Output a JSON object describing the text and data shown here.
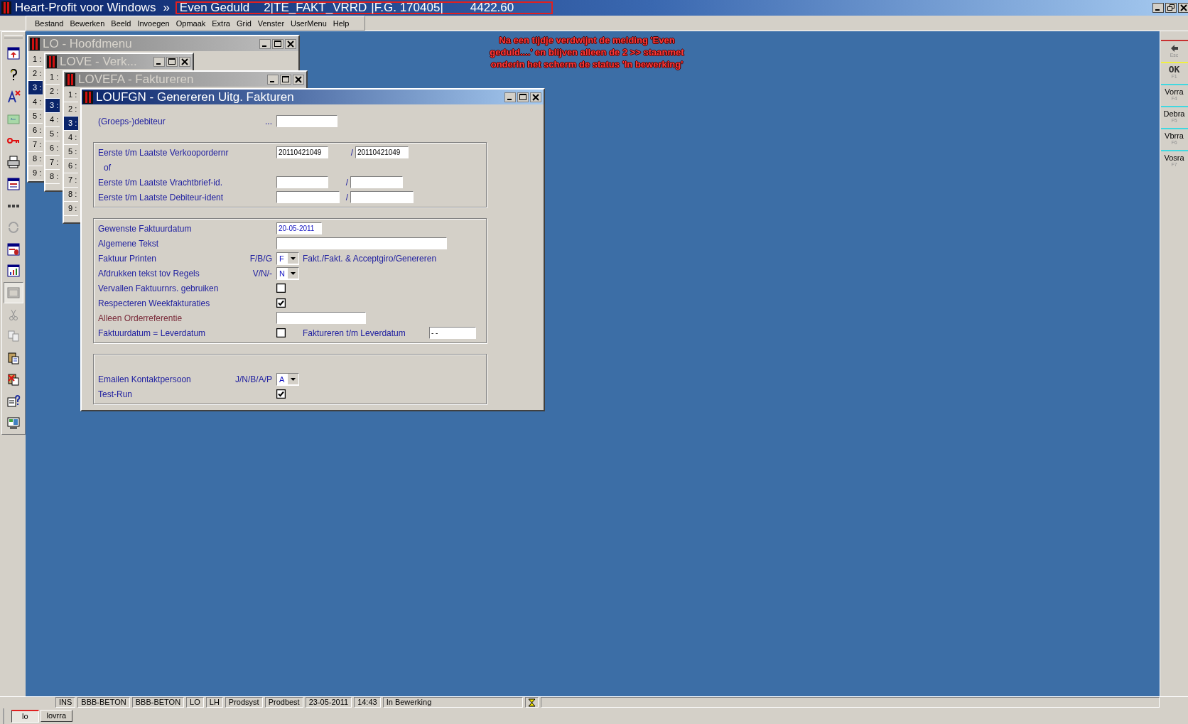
{
  "app_title": {
    "name": "Heart-Profit voor Windows",
    "separator": "»",
    "status": [
      "Even Geduld",
      "2|TE_FAKT_VRRD",
      "|F.G. 170405|",
      "4422.60"
    ]
  },
  "menu": [
    "Bestand",
    "Bewerken",
    "Beeld",
    "Invoegen",
    "Opmaak",
    "Extra",
    "Grid",
    "Venster",
    "UserMenu",
    "Help"
  ],
  "annotation": [
    "Na een tijdje verdwijnt de melding 'Even",
    "geduld....' en blijven alleen de 2 >> staanmet",
    "onderin het scherm de status 'In bewerking'"
  ],
  "windows": [
    {
      "title": "LO - Hoofdmenu",
      "active": false,
      "items": [
        {
          "label": "1 :",
          "selected": false
        },
        {
          "label": "2 :",
          "selected": false
        },
        {
          "label": "3 :",
          "selected": true
        },
        {
          "label": "4 :",
          "selected": false
        },
        {
          "label": "5 :",
          "selected": false
        },
        {
          "label": "6 :",
          "selected": false
        },
        {
          "label": "7 :",
          "selected": false
        },
        {
          "label": "8 :",
          "selected": false
        },
        {
          "label": "9 :",
          "selected": false
        }
      ]
    },
    {
      "title": "LOVE - Verk...",
      "active": false,
      "items": [
        {
          "label": "1 :",
          "selected": false
        },
        {
          "label": "2 :",
          "selected": false
        },
        {
          "label": "3 :",
          "selected": true
        },
        {
          "label": "4 :",
          "selected": false
        },
        {
          "label": "5 :",
          "selected": false
        },
        {
          "label": "6 :",
          "selected": false
        },
        {
          "label": "7 :",
          "selected": false
        },
        {
          "label": "8 :",
          "selected": false
        }
      ]
    },
    {
      "title": "LOVEFA - Faktureren",
      "active": false,
      "items": [
        {
          "label": "1 :",
          "selected": false
        },
        {
          "label": "2 :",
          "selected": false
        },
        {
          "label": "3 :",
          "selected": true
        },
        {
          "label": "4 :",
          "selected": false
        },
        {
          "label": "5 :",
          "selected": false
        },
        {
          "label": "6 :",
          "selected": false
        },
        {
          "label": "7 :",
          "selected": false
        },
        {
          "label": "8 :",
          "selected": false
        },
        {
          "label": "9 :",
          "selected": false
        }
      ]
    }
  ],
  "dialog": {
    "title": "LOUFGN - Genereren Uitg. Fakturen",
    "active": true,
    "sections": [
      {
        "boxed": false,
        "rows": [
          {
            "kind": "text",
            "label": "(Groeps-)debiteur",
            "code": "..."
          }
        ]
      },
      {
        "boxed": true,
        "rows": [
          {
            "kind": "range",
            "label": "Eerste t/m Laatste Verkoopordernr",
            "from": "20110421049",
            "separator": "/",
            "to": "20110421049"
          },
          {
            "kind": "note",
            "label": "of"
          },
          {
            "kind": "range",
            "label": "Eerste t/m Laatste Vrachtbrief-id.",
            "separator": "/"
          },
          {
            "kind": "range",
            "label": "Eerste t/m Laatste Debiteur-ident",
            "separator": "/"
          }
        ]
      },
      {
        "boxed": true,
        "rows": [
          {
            "kind": "text",
            "label": "Gewenste Faktuurdatum",
            "value": "20-05-2011"
          },
          {
            "kind": "text",
            "label": "Algemene Tekst"
          },
          {
            "kind": "select",
            "label": "Faktuur Printen",
            "code": "F/B/G",
            "value": "F",
            "hint": "Fakt./Fakt. & Acceptgiro/Genereren"
          },
          {
            "kind": "select",
            "label": "Afdrukken tekst tov Regels",
            "code": "V/N/-",
            "value": "N"
          },
          {
            "kind": "checkbox",
            "label": "Vervallen Faktuurnrs. gebruiken",
            "checked": false
          },
          {
            "kind": "checkbox",
            "label": "Respecteren Weekfakturaties",
            "checked": true
          },
          {
            "kind": "text",
            "label": "Alleen Orderreferentie",
            "color": "#7a2b3a"
          },
          {
            "kind": "checkbox",
            "label": "Faktuurdatum = Leverdatum",
            "checked": false,
            "extra_label": "Faktureren t/m Leverdatum",
            "extra_value": "- -"
          }
        ]
      },
      {
        "boxed": true,
        "rows": [
          {
            "kind": "blank"
          },
          {
            "kind": "select",
            "label": "Emailen Kontaktpersoon",
            "code": "J/N/B/A/P",
            "value": "A"
          },
          {
            "kind": "checkbox",
            "label": "Test-Run",
            "checked": true
          }
        ]
      }
    ]
  },
  "right_toolbar": [
    {
      "kind": "icon",
      "key": "Esc",
      "color": "#c83030"
    },
    {
      "kind": "text",
      "label": "OK",
      "key": "F1",
      "color": "#f0f040"
    },
    {
      "kind": "text",
      "label": "Vorra",
      "key": "F4",
      "color": "#40d8e0"
    },
    {
      "kind": "text",
      "label": "Debra",
      "key": "F5",
      "color": "#40d8e0"
    },
    {
      "kind": "text",
      "label": "Vbrra",
      "key": "F6",
      "color": "#40d8e0"
    },
    {
      "kind": "text",
      "label": "Vosra",
      "key": "F7",
      "color": "#40d8e0"
    }
  ],
  "status_bar": [
    "INS",
    "BBB-BETON",
    "BBB-BETON",
    "LO",
    "LH",
    "Prodsyst",
    "Prodbest",
    "23-05-2011",
    "14:43",
    "In Bewerking"
  ],
  "taskbar": [
    {
      "label": "lo",
      "selected": true
    },
    {
      "label": "lovrra",
      "selected": false
    }
  ]
}
